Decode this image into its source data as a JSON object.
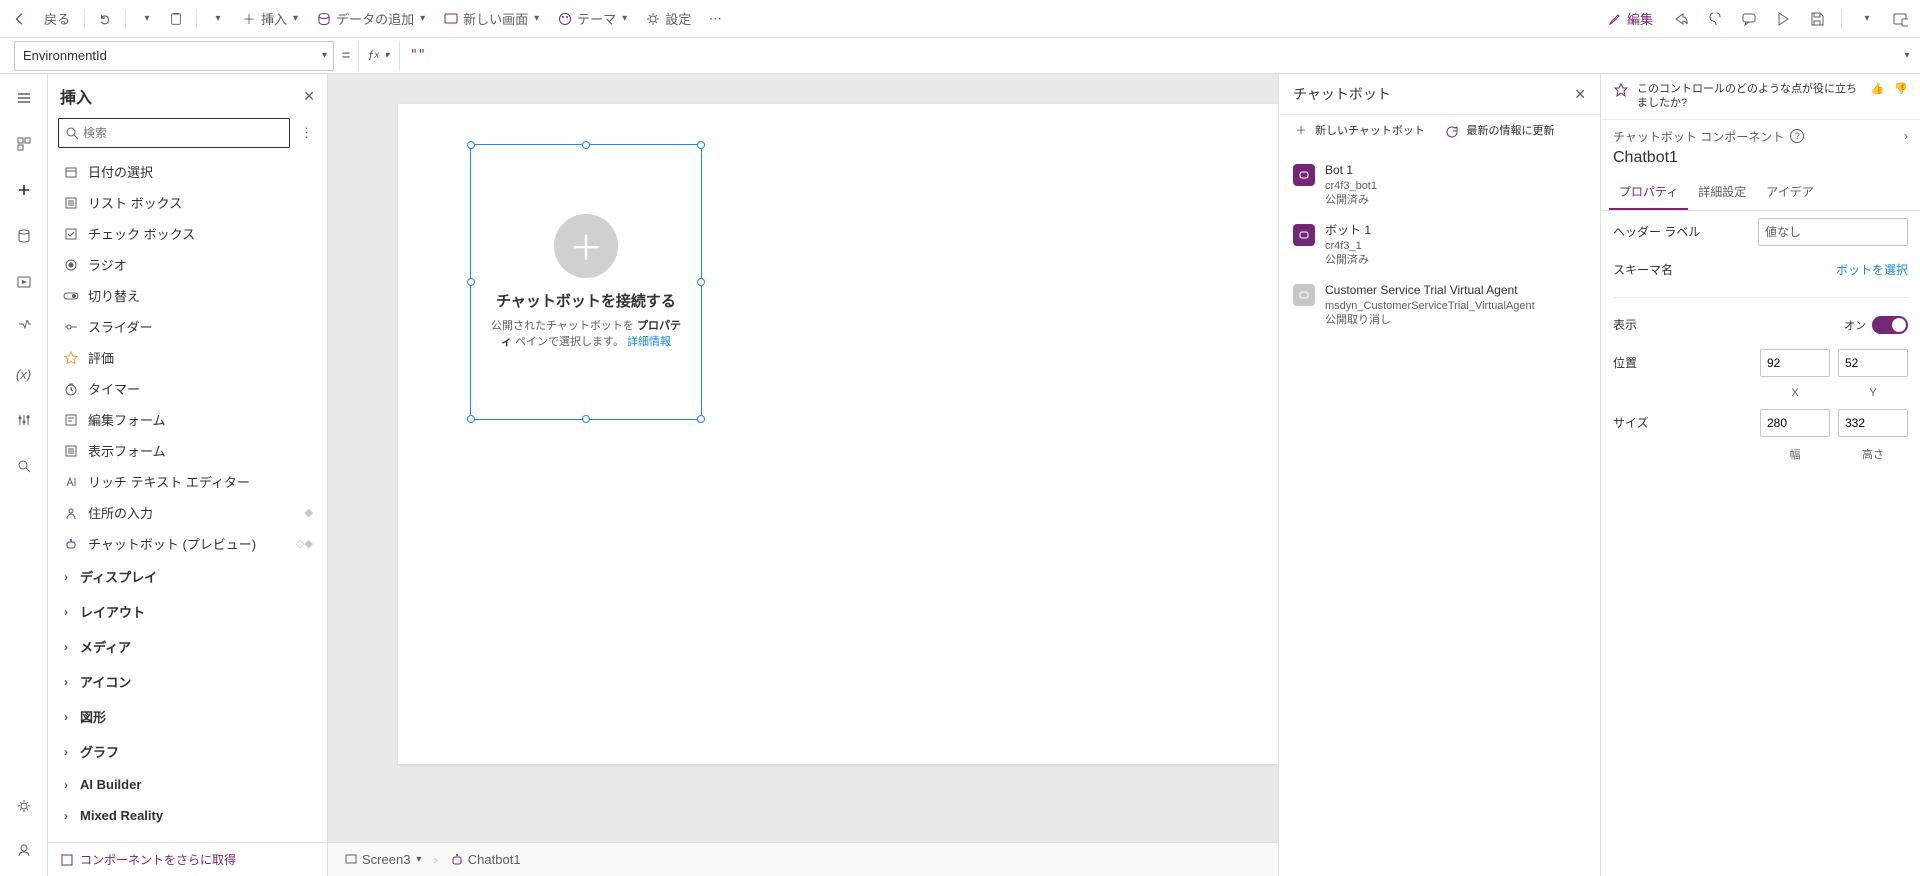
{
  "topbar": {
    "back": "戻る",
    "insert": "挿入",
    "addData": "データの追加",
    "newScreen": "新しい画面",
    "theme": "テーマ",
    "settings": "設定",
    "edit": "編集"
  },
  "formula": {
    "property": "EnvironmentId",
    "value": "\"\""
  },
  "insertPanel": {
    "title": "挿入",
    "searchPlaceholder": "検索",
    "items": [
      {
        "label": "日付の選択",
        "icon": "calendar-icon"
      },
      {
        "label": "リスト ボックス",
        "icon": "listbox-icon"
      },
      {
        "label": "チェック ボックス",
        "icon": "checkbox-icon"
      },
      {
        "label": "ラジオ",
        "icon": "radio-icon"
      },
      {
        "label": "切り替え",
        "icon": "toggle-icon"
      },
      {
        "label": "スライダー",
        "icon": "slider-icon"
      },
      {
        "label": "評価",
        "icon": "star-icon"
      },
      {
        "label": "タイマー",
        "icon": "timer-icon"
      },
      {
        "label": "編集フォーム",
        "icon": "form-edit-icon"
      },
      {
        "label": "表示フォーム",
        "icon": "form-view-icon"
      },
      {
        "label": "リッチ テキスト エディター",
        "icon": "richtext-icon"
      },
      {
        "label": "住所の入力",
        "icon": "address-icon",
        "badge": "◆"
      },
      {
        "label": "チャットボット (プレビュー)",
        "icon": "bot-icon",
        "badge": "◇◆"
      }
    ],
    "groups": [
      "ディスプレイ",
      "レイアウト",
      "メディア",
      "アイコン",
      "図形",
      "グラフ",
      "AI Builder",
      "Mixed Reality"
    ],
    "footer": "コンポーネントをさらに取得"
  },
  "canvas": {
    "placeholder": {
      "title": "チャットボットを接続する",
      "sub1": "公開されたチャットボットを ",
      "subBold": "プロパティ",
      "sub2": " ペインで選択します。",
      "link": "詳細情報"
    },
    "breadcrumb": {
      "screen": "Screen3",
      "control": "Chatbot1"
    }
  },
  "chatPanel": {
    "title": "チャットボット",
    "newBot": "新しいチャットボット",
    "refresh": "最新の情報に更新",
    "bots": [
      {
        "name": "Bot 1",
        "id": "cr4f3_bot1",
        "status": "公開済み",
        "color": "purple"
      },
      {
        "name": "ボット 1",
        "id": "cr4f3_1",
        "status": "公開済み",
        "color": "purple"
      },
      {
        "name": "Customer Service Trial Virtual Agent",
        "id": "msdyn_CustomerServiceTrial_VirtualAgent",
        "status": "公開取り消し",
        "color": "grey"
      }
    ]
  },
  "propPanel": {
    "feedback": "このコントロールのどのような点が役に立ちましたか?",
    "componentType": "チャットボット コンポーネント",
    "componentName": "Chatbot1",
    "tabs": [
      "プロパティ",
      "詳細設定",
      "アイデア"
    ],
    "rows": {
      "headerLabel": {
        "label": "ヘッダー ラベル",
        "value": "値なし"
      },
      "schemaName": {
        "label": "スキーマ名",
        "link": "ボットを選択"
      },
      "display": {
        "label": "表示",
        "on": "オン"
      },
      "position": {
        "label": "位置",
        "x": "92",
        "y": "52",
        "xl": "X",
        "yl": "Y"
      },
      "size": {
        "label": "サイズ",
        "w": "280",
        "h": "332",
        "wl": "幅",
        "hl": "高さ"
      }
    }
  }
}
